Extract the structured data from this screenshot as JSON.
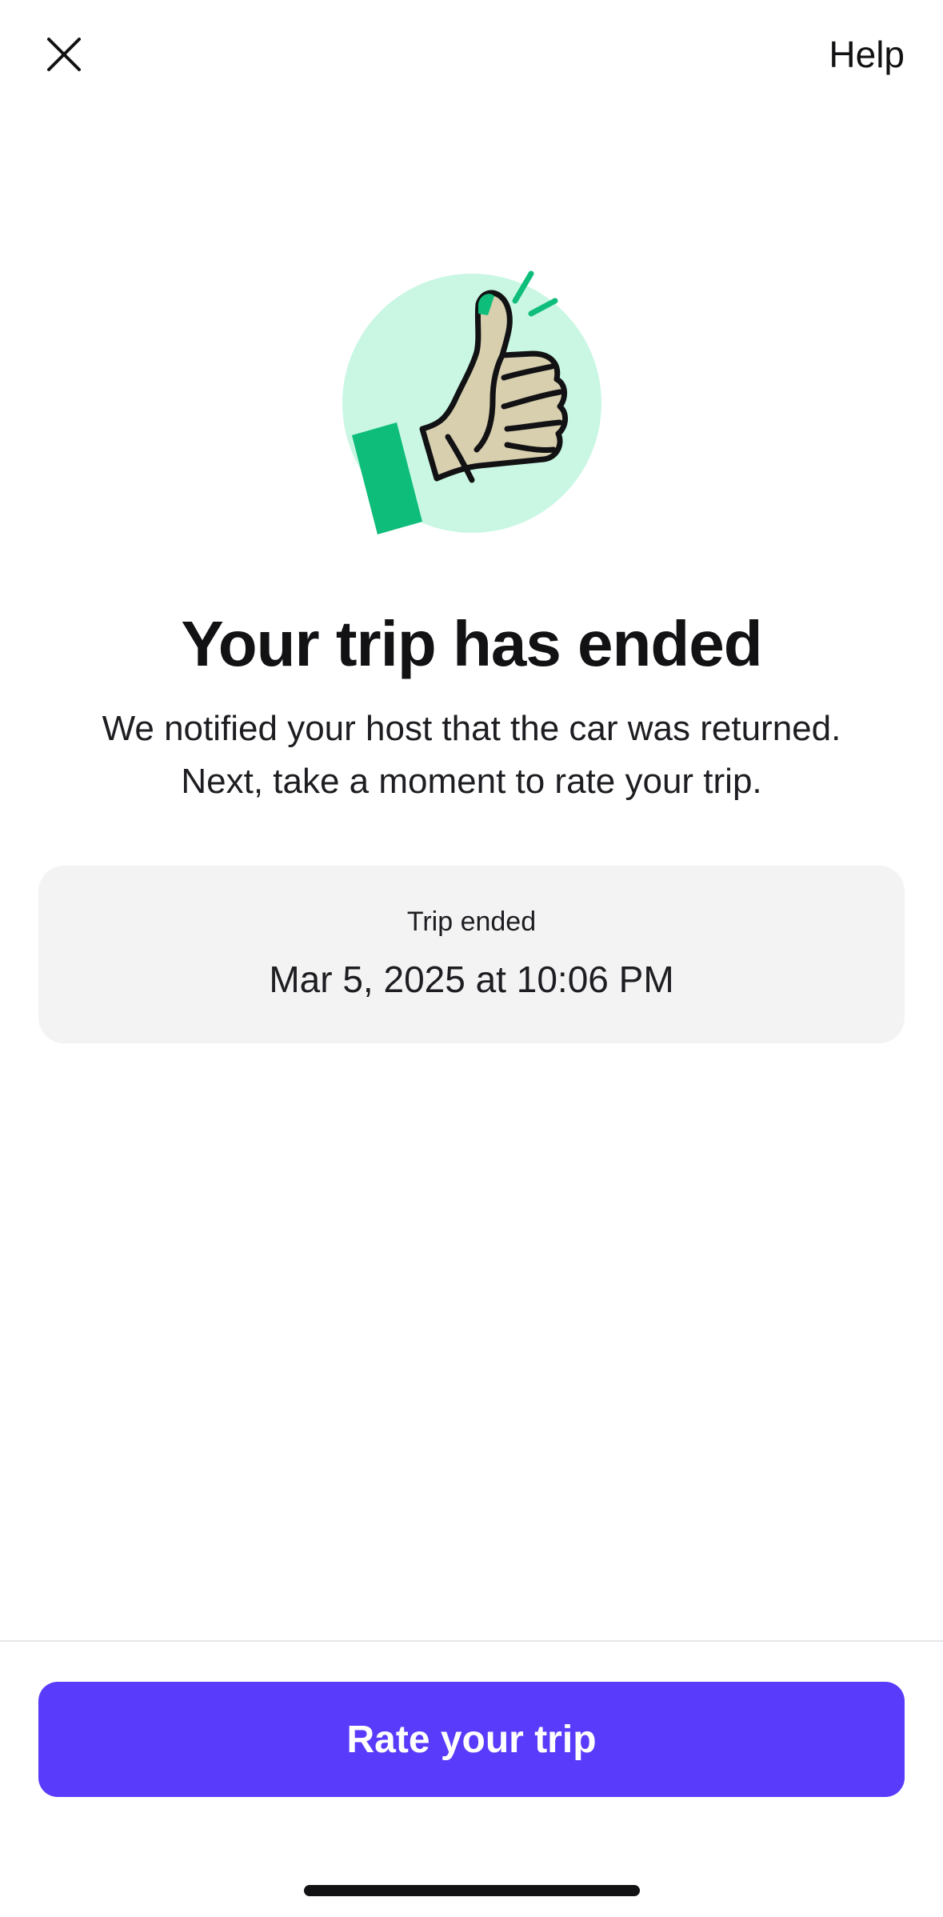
{
  "header": {
    "close_icon": "close-icon",
    "help_label": "Help"
  },
  "illustration": {
    "icon": "thumbs-up-illustration",
    "circle_color": "#c9f7e3",
    "accent_color": "#0fbd7b",
    "skin_color": "#d7cfae"
  },
  "main": {
    "title": "Your trip has ended",
    "description_line1": "We notified your host that the car was returned.",
    "description_line2": "Next, take a moment to rate your trip."
  },
  "trip_card": {
    "label": "Trip ended",
    "value": "Mar 5, 2025 at 10:06 PM"
  },
  "footer": {
    "primary_button_label": "Rate your trip",
    "primary_color": "#593cfb"
  }
}
